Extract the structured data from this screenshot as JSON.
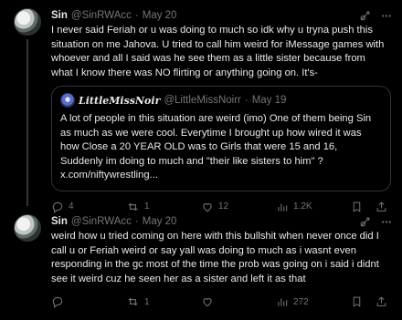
{
  "tweets": [
    {
      "display_name": "Sin",
      "handle": "@SinRWAcc",
      "separator": "·",
      "date": "May 20",
      "text": "I never said Feriah or u was doing to much so idk why u tryna push this situation on me Jahova. U tried to call him weird for iMessage games with whoever and all I said was he see them as a little sister because from what I know there was NO flirting or anything going on. It's-",
      "quote": {
        "display_name": "LittleMissNoir",
        "handle": "@LittleMissNoirr",
        "separator": "·",
        "date": "May 19",
        "text": "A lot of people in this situation are weird (imo) One of them being Sin as much as we were cool. Everytime I brought up how wired it was how Close a 20 YEAR OLD was to Girls that were 15 and 16, Suddenly im doing to much and \"their like sisters to him\" ? x.com/niftywrestling..."
      },
      "stats": {
        "replies": "4",
        "reposts": "1",
        "likes": "12",
        "views": "1.2K"
      }
    },
    {
      "display_name": "Sin",
      "handle": "@SinRWAcc",
      "separator": "·",
      "date": "May 20",
      "text": "weird how u tried coming on here with this bullshit when never once did I call u or Feriah weird or say yall was doing to much as i wasnt even responding in the gc most of the time the prob was going on i said i didnt see it weird cuz he seen her as a sister and left it as that",
      "stats": {
        "replies": "",
        "reposts": "1",
        "likes": "",
        "views": "272"
      }
    }
  ],
  "icons": {
    "grok": "grok-icon",
    "more": "more-icon",
    "reply": "reply-icon",
    "repost": "repost-icon",
    "like": "like-icon",
    "views": "views-icon",
    "bookmark": "bookmark-icon",
    "share": "share-icon"
  },
  "colors": {
    "background": "#000000",
    "text": "#e7e9ea",
    "secondary": "#71767b",
    "border": "#2f3336"
  }
}
